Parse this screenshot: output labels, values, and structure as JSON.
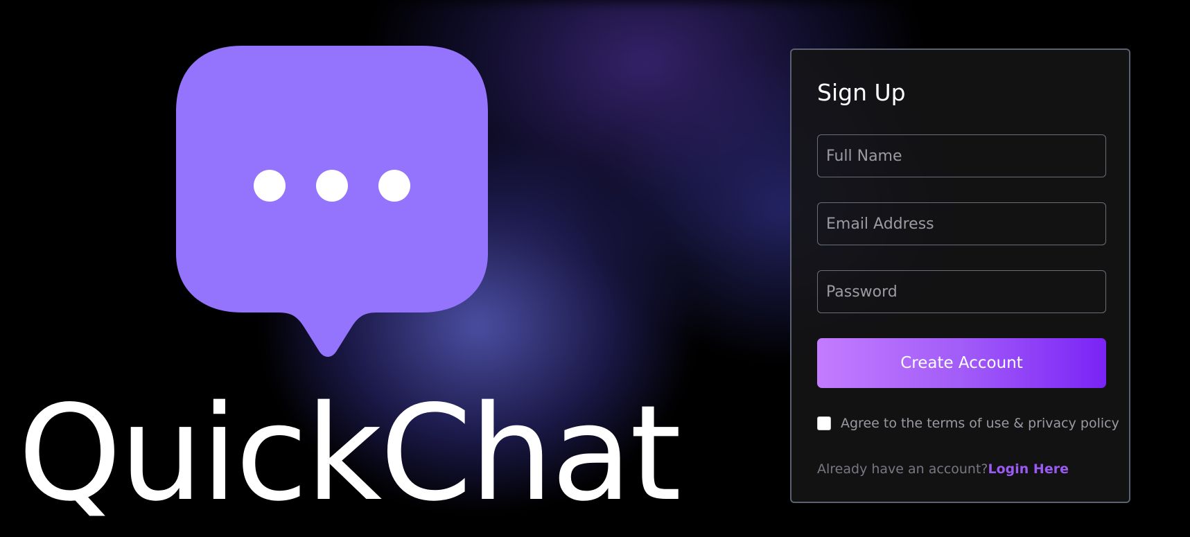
{
  "brand": {
    "name": "QuickChat",
    "logo_icon": "chat-bubble-ellipsis-icon",
    "logo_color": "#9473fd"
  },
  "signup": {
    "title": "Sign Up",
    "fields": {
      "full_name_placeholder": "Full Name",
      "email_placeholder": "Email Address",
      "password_placeholder": "Password"
    },
    "submit_label": "Create Account",
    "terms_label": "Agree to the terms of use & privacy policy",
    "terms_checked": false,
    "login_prompt": "Already have an account?",
    "login_link": "Login Here"
  },
  "colors": {
    "accent_start": "#c37cff",
    "accent_end": "#7a23f6",
    "link": "#9a5bf5",
    "card_background": "#141416",
    "card_border": "#5b6170"
  }
}
